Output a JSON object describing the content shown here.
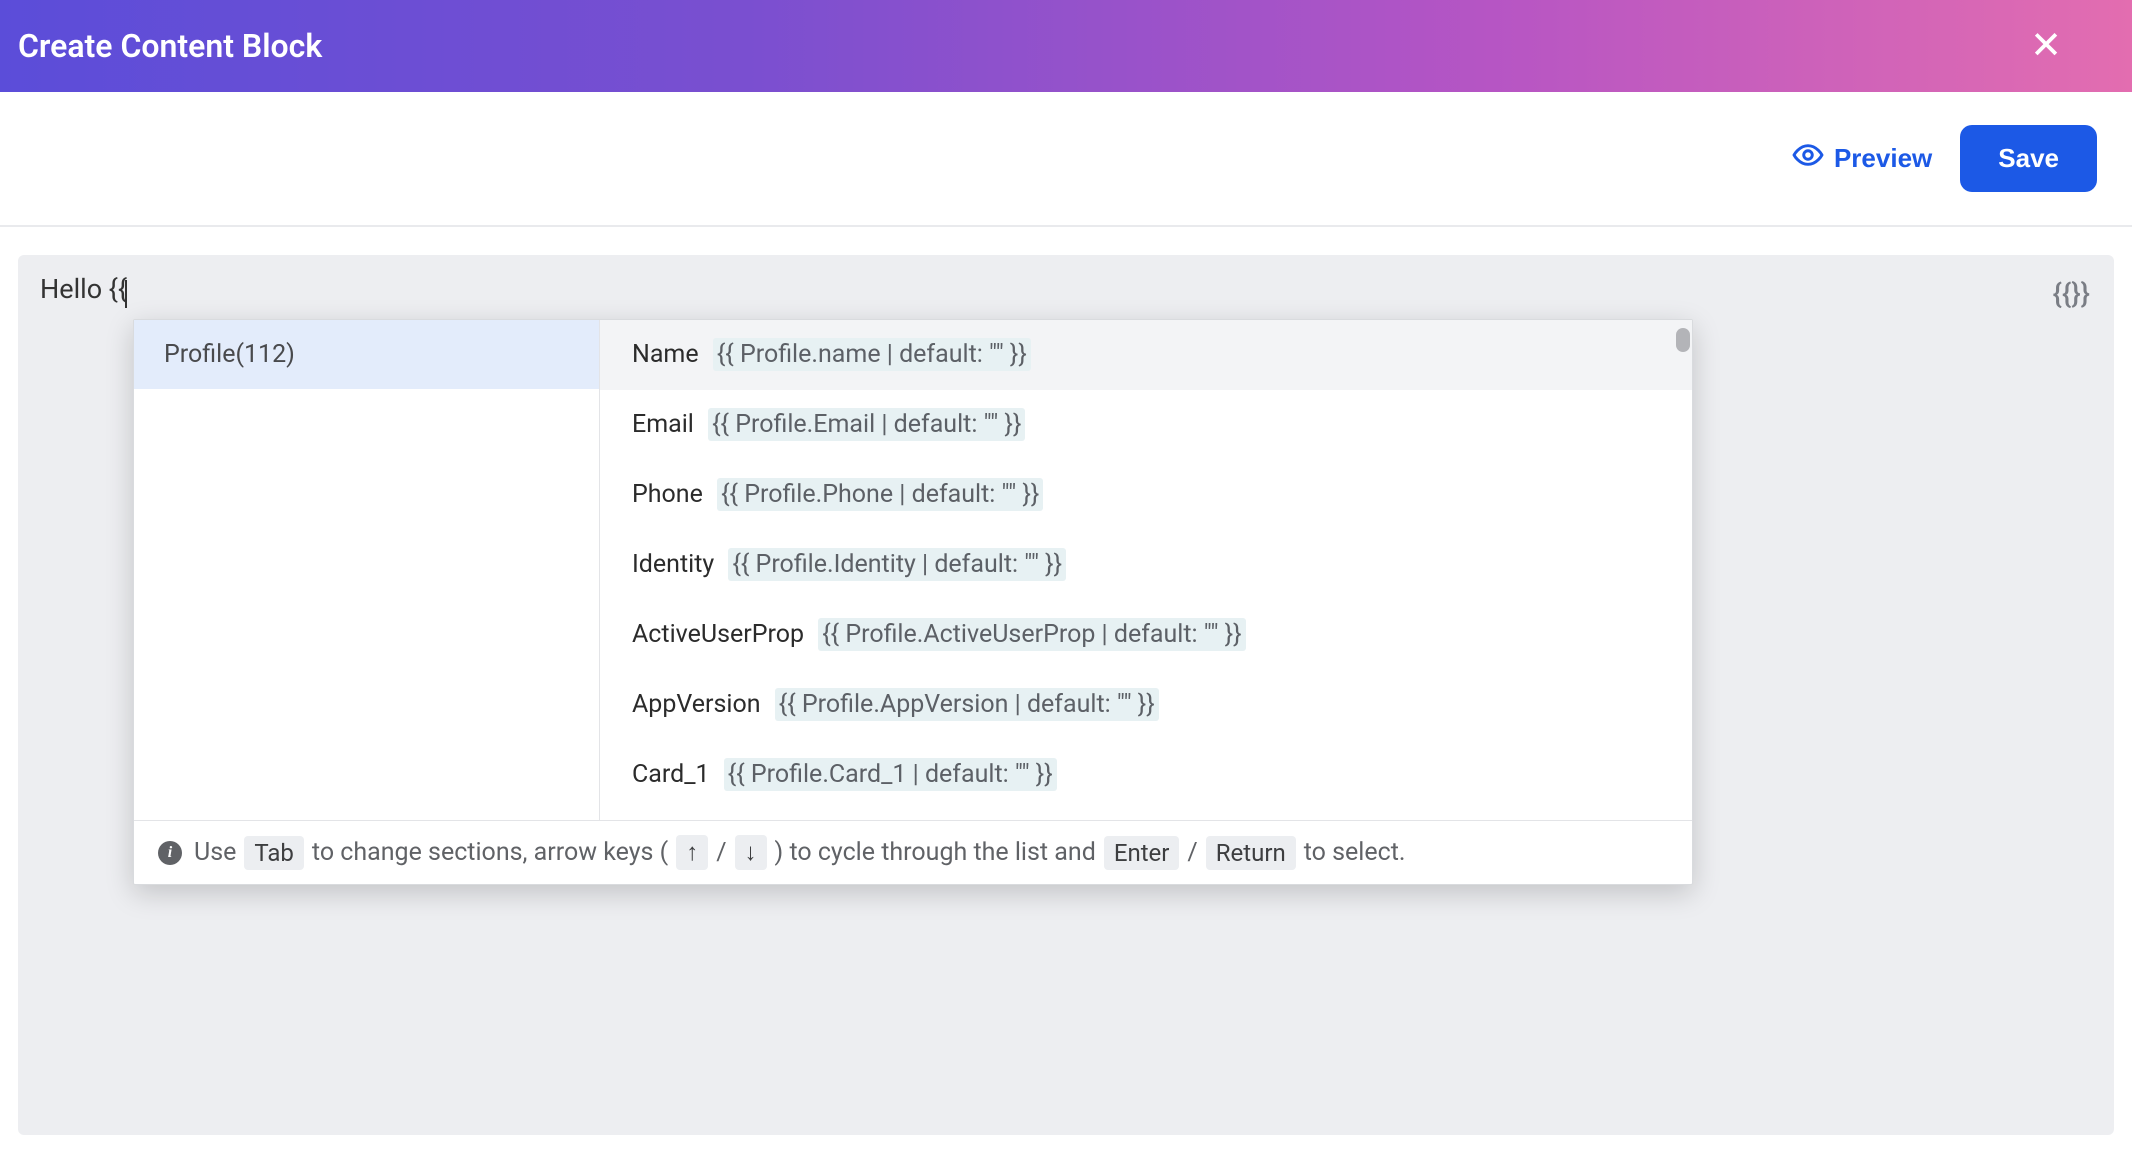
{
  "header": {
    "title": "Create Content Block",
    "close_icon": "close-icon"
  },
  "toolbar": {
    "preview_label": "Preview",
    "save_label": "Save"
  },
  "editor": {
    "current_text": "Hello {{",
    "liquid_button_icon": "liquid-braces-icon"
  },
  "autocomplete": {
    "categories": [
      {
        "label": "Profile(112)",
        "active": true
      }
    ],
    "attributes": [
      {
        "label": "Name",
        "liquid": "{{ Profile.name | default: \"\" }}",
        "highlighted": true
      },
      {
        "label": "Email",
        "liquid": "{{ Profile.Email | default: \"\" }}",
        "highlighted": false
      },
      {
        "label": "Phone",
        "liquid": "{{ Profile.Phone | default: \"\" }}",
        "highlighted": false
      },
      {
        "label": "Identity",
        "liquid": "{{ Profile.Identity | default: \"\" }}",
        "highlighted": false
      },
      {
        "label": "ActiveUserProp",
        "liquid": "{{ Profile.ActiveUserProp | default: \"\" }}",
        "highlighted": false
      },
      {
        "label": "AppVersion",
        "liquid": "{{ Profile.AppVersion | default: \"\" }}",
        "highlighted": false
      },
      {
        "label": "Card_1",
        "liquid": "{{ Profile.Card_1 | default: \"\" }}",
        "highlighted": false
      }
    ],
    "hint": {
      "prefix": "Use",
      "tab_key": "Tab",
      "segment1": "to change sections, arrow keys (",
      "up_key": "↑",
      "slash1": "/",
      "down_key": "↓",
      "segment2": ") to cycle through the list and",
      "enter_key": "Enter",
      "slash2": "/",
      "return_key": "Return",
      "suffix": "to select."
    }
  }
}
